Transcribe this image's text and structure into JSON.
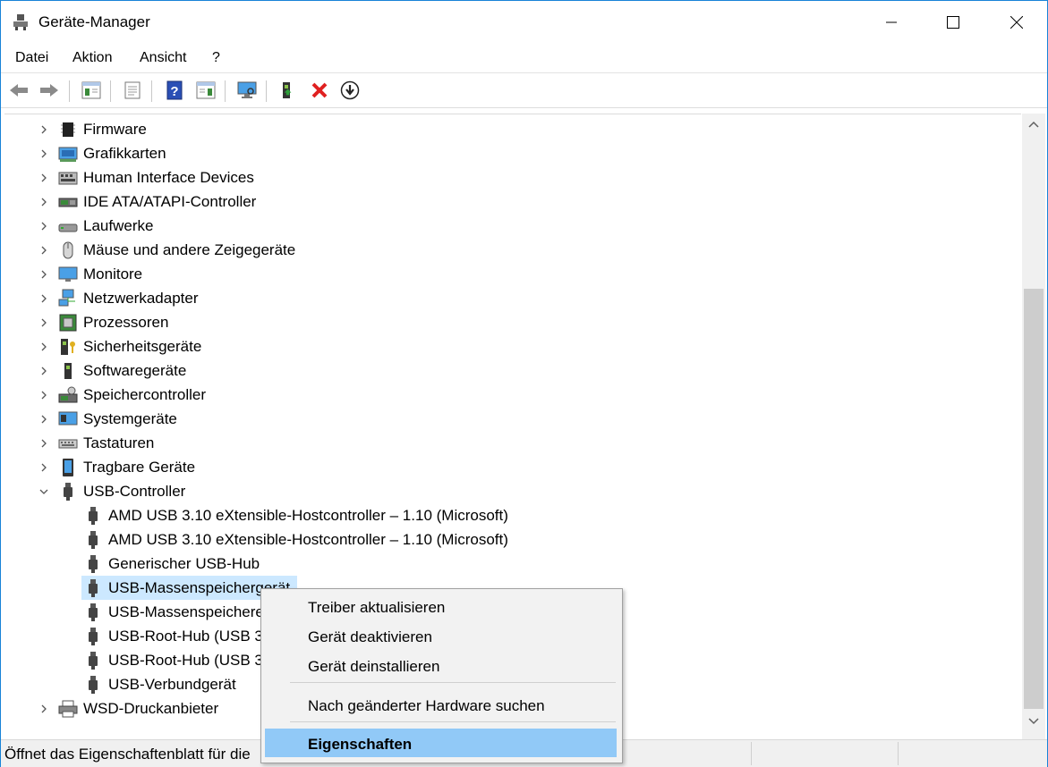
{
  "window": {
    "title": "Geräte-Manager"
  },
  "menu": [
    "Datei",
    "Aktion",
    "Ansicht",
    "?"
  ],
  "tree": {
    "categories": [
      "Firmware",
      "Grafikkarten",
      "Human Interface Devices",
      "IDE ATA/ATAPI-Controller",
      "Laufwerke",
      "Mäuse und andere Zeigegeräte",
      "Monitore",
      "Netzwerkadapter",
      "Prozessoren",
      "Sicherheitsgeräte",
      "Softwaregeräte",
      "Speichercontroller",
      "Systemgeräte",
      "Tastaturen",
      "Tragbare Geräte"
    ],
    "usb_controller": "USB-Controller",
    "usb_children": [
      "AMD USB 3.10 eXtensible-Hostcontroller – 1.10 (Microsoft)",
      "AMD USB 3.10 eXtensible-Hostcontroller – 1.10 (Microsoft)",
      "Generischer USB-Hub",
      "USB-Massenspeichergerät",
      "USB-Massenspeichere",
      "USB-Root-Hub (USB 3",
      "USB-Root-Hub (USB 3",
      "USB-Verbundgerät"
    ],
    "last_category": "WSD-Druckanbieter"
  },
  "context_menu": {
    "items": [
      "Treiber aktualisieren",
      "Gerät deaktivieren",
      "Gerät deinstallieren",
      "Nach geänderter Hardware suchen",
      "Eigenschaften"
    ]
  },
  "status": {
    "text": "Öffnet das Eigenschaftenblatt für die"
  }
}
